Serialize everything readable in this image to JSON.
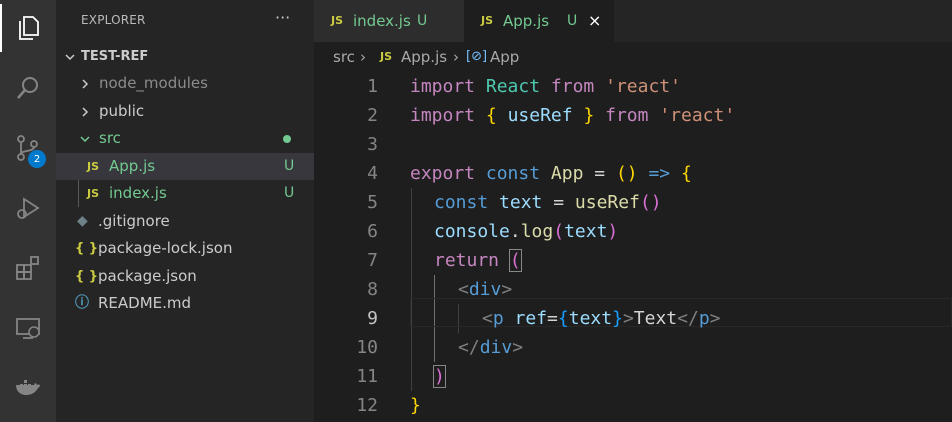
{
  "activity_bar": {
    "icons": [
      "explorer-icon",
      "search-icon",
      "source-control-icon",
      "run-debug-icon",
      "extensions-icon",
      "remote-explorer-icon",
      "docker-icon"
    ],
    "source_control_badge": "2"
  },
  "sidebar": {
    "title": "EXPLORER",
    "more": "···",
    "project": "TEST-REF",
    "items": [
      {
        "label": "node_modules",
        "type": "folder"
      },
      {
        "label": "public",
        "type": "folder"
      },
      {
        "label": "src",
        "type": "folder-open"
      },
      {
        "label": "App.js",
        "icon": "JS",
        "status": "U"
      },
      {
        "label": "index.js",
        "icon": "JS",
        "status": "U"
      },
      {
        "label": ".gitignore",
        "icon": "git-icon"
      },
      {
        "label": "package-lock.json",
        "icon": "{ }"
      },
      {
        "label": "package.json",
        "icon": "{ }"
      },
      {
        "label": "README.md",
        "icon": "info-icon"
      }
    ]
  },
  "tabs": [
    {
      "icon": "JS",
      "label": "index.js",
      "status": "U",
      "active": false
    },
    {
      "icon": "JS",
      "label": "App.js",
      "status": "U",
      "active": true,
      "close": "×"
    }
  ],
  "breadcrumb": {
    "folder": "src",
    "file_icon": "JS",
    "file": "App.js",
    "symbol_icon": "[⊘]",
    "symbol": "App"
  },
  "editor": {
    "line_numbers": [
      "1",
      "2",
      "3",
      "4",
      "5",
      "6",
      "7",
      "8",
      "9",
      "10",
      "11",
      "12"
    ],
    "current_line": "9",
    "code": {
      "l1": [
        "import",
        " ",
        "React",
        " ",
        "from",
        " ",
        "'react'"
      ],
      "l2": [
        "import",
        " ",
        "{",
        " ",
        "useRef",
        " ",
        "}",
        " ",
        "from",
        " ",
        "'react'"
      ],
      "l4": [
        "export",
        " ",
        "const",
        " ",
        "App",
        " = ",
        "(",
        ")",
        " ",
        "=>",
        " ",
        "{"
      ],
      "l5": [
        "const",
        " ",
        "text",
        " = ",
        "useRef",
        "(",
        ")"
      ],
      "l6": [
        "console",
        ".",
        "log",
        "(",
        "text",
        ")"
      ],
      "l7": [
        "return",
        " ",
        "("
      ],
      "l8": [
        "<",
        "div",
        ">"
      ],
      "l9": [
        "<",
        "p",
        " ",
        "ref",
        "=",
        "{",
        "text",
        "}",
        ">",
        "Text",
        "</",
        "p",
        ">"
      ],
      "l10": [
        "</",
        "div",
        ">"
      ],
      "l11": [
        ")"
      ],
      "l12": [
        "}"
      ]
    }
  },
  "colors": {
    "accent": "#007acc",
    "untracked": "#73c991",
    "keyword": "#569cd6",
    "control_keyword": "#c586c0",
    "string": "#ce9178"
  }
}
